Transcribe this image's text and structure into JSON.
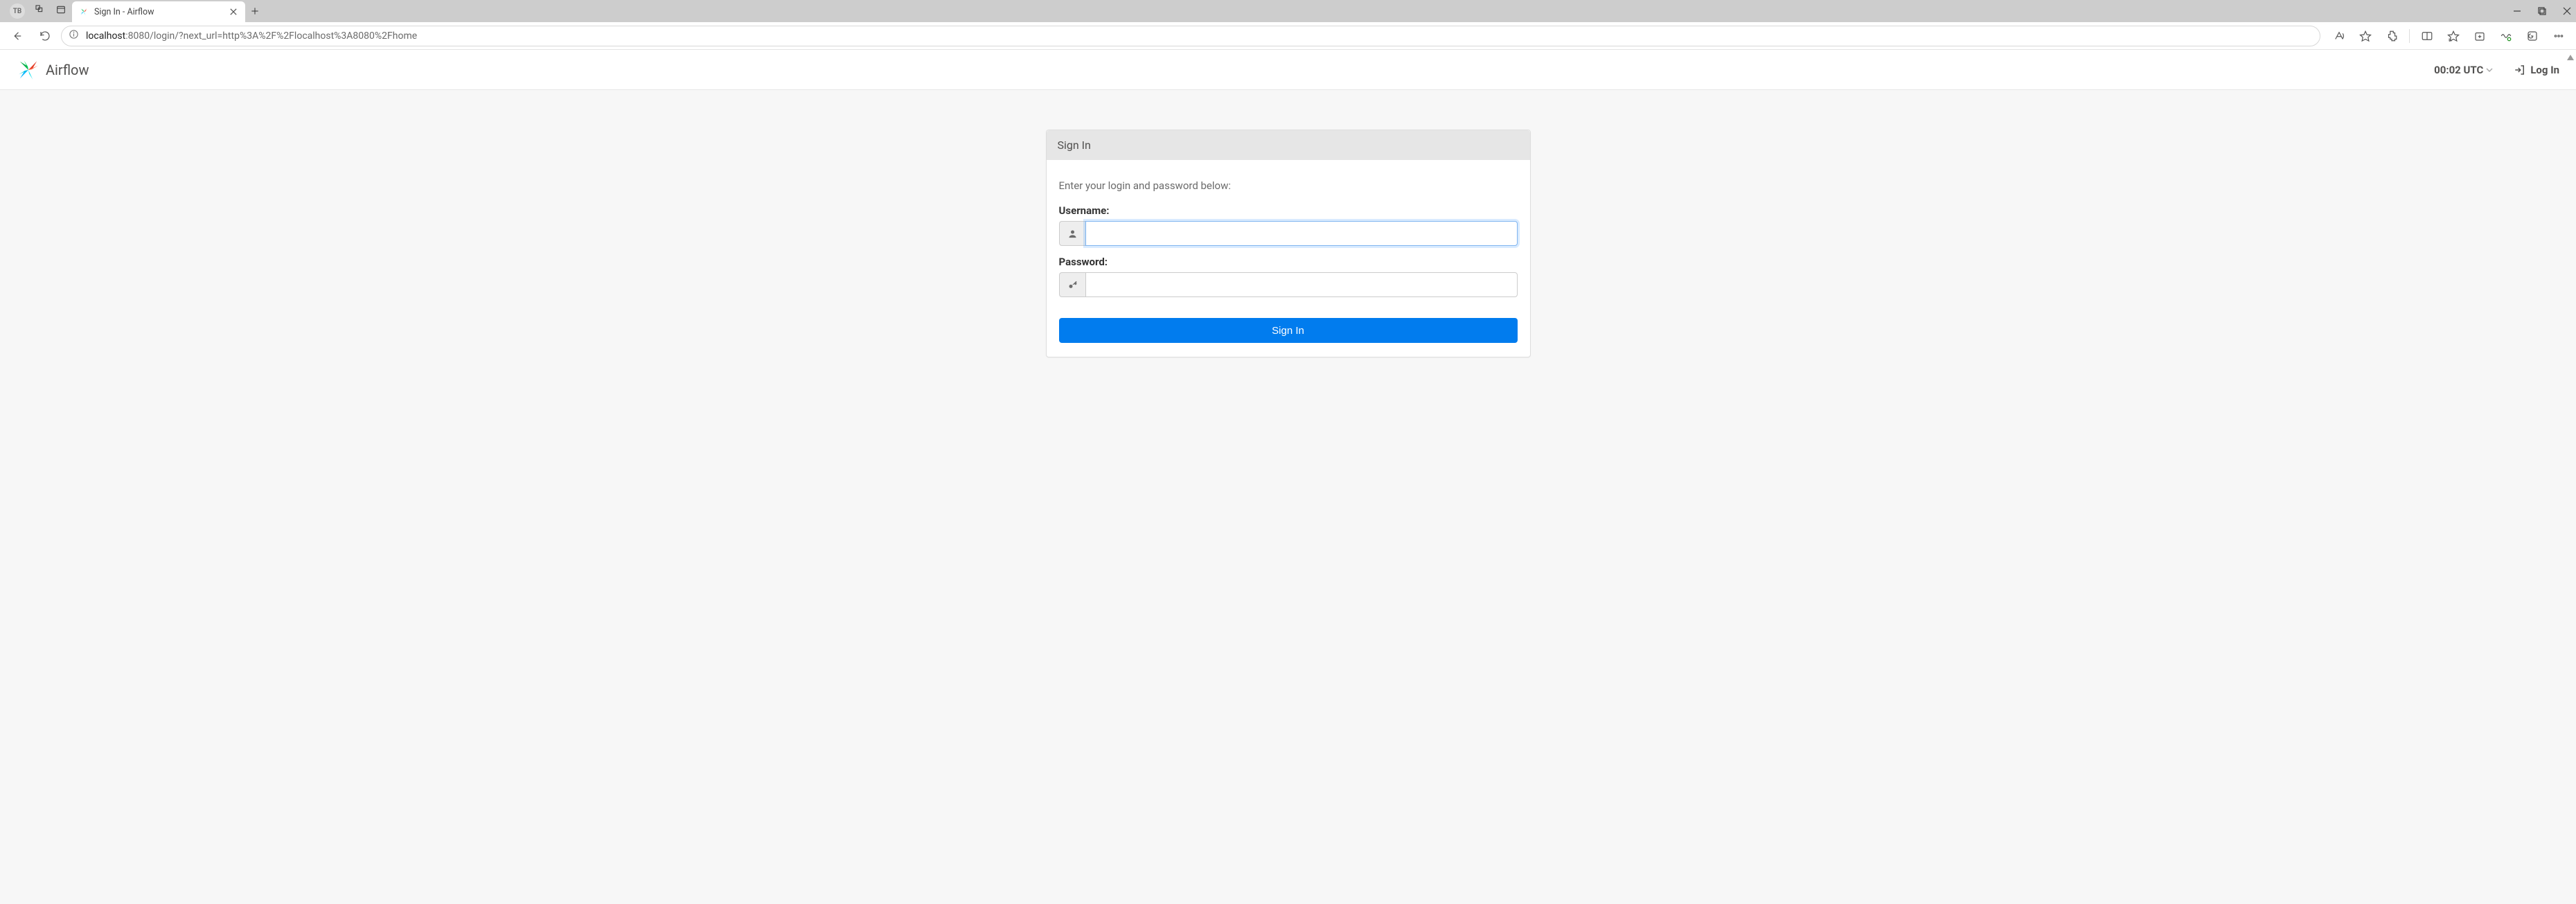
{
  "browser": {
    "profile_initials": "TB",
    "tab_title": "Sign In - Airflow",
    "url_host": "localhost",
    "url_port_path": ":8080/login/?next_url=http%3A%2F%2Flocalhost%3A8080%2Fhome"
  },
  "navbar": {
    "brand": "Airflow",
    "clock": "00:02 UTC",
    "login_label": "Log In"
  },
  "panel": {
    "title": "Sign In",
    "hint": "Enter your login and password below:",
    "username_label": "Username:",
    "password_label": "Password:",
    "username_value": "",
    "password_value": "",
    "submit_label": "Sign In"
  }
}
